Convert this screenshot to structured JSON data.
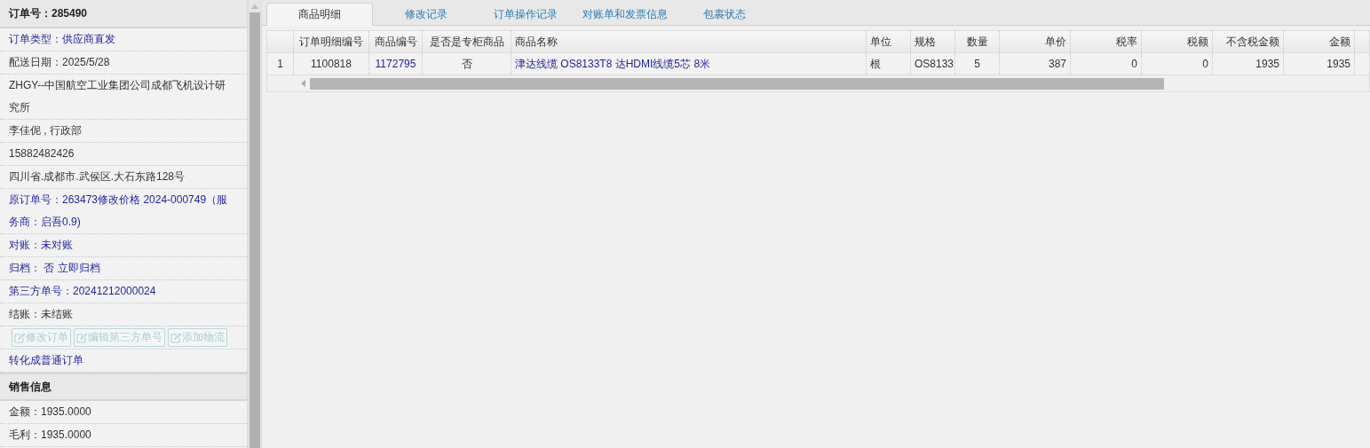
{
  "sidebar": {
    "title": "订单号：285490",
    "rows": [
      {
        "text": "订单类型：供应商直发",
        "kind": "link"
      },
      {
        "text": "配送日期：2025/5/28",
        "kind": "text"
      },
      {
        "text": "ZHGY--中国航空工业集团公司成都飞机设计研究所",
        "kind": "text"
      },
      {
        "text": "李佳伲 , 行政部",
        "kind": "text"
      },
      {
        "text": "15882482426",
        "kind": "text"
      },
      {
        "text": "四川省.成都市.武侯区.大石东路128号",
        "kind": "text"
      },
      {
        "text": "原订单号：263473修改价格 2024-000749（服务商：启吾0.9)",
        "kind": "link"
      },
      {
        "text": "对账：未对账",
        "kind": "link"
      },
      {
        "text": "归档： 否 立即归档",
        "kind": "link"
      },
      {
        "text": "第三方单号：20241212000024",
        "kind": "link"
      },
      {
        "text": "结账：未结账",
        "kind": "text"
      }
    ],
    "buttons": [
      {
        "label": "修改订单",
        "disabled": true
      },
      {
        "label": "编辑第三方单号",
        "disabled": true
      },
      {
        "label": "添加物流",
        "disabled": true
      }
    ],
    "convert_link": "转化成普通订单",
    "sales_title": "销售信息",
    "sales_rows": [
      "金额：1935.0000",
      "毛利：1935.0000"
    ]
  },
  "tabs": [
    {
      "label": "商品明细",
      "selected": true
    },
    {
      "label": "修改记录",
      "selected": false
    },
    {
      "label": "订单操作记录",
      "selected": false
    },
    {
      "label": "对账单和发票信息",
      "selected": false
    },
    {
      "label": "包裹状态",
      "selected": false
    }
  ],
  "table": {
    "columns": [
      "订单明细编号",
      "商品编号",
      "是否是专柜商品",
      "商品名称",
      "单位",
      "规格",
      "数量",
      "单价",
      "税率",
      "税额",
      "不含税金额",
      "金额"
    ],
    "rows": [
      {
        "number": "1",
        "cells": [
          {
            "text": "1100818",
            "link": false
          },
          {
            "text": "1172795",
            "link": true
          },
          {
            "text": "否",
            "link": false
          },
          {
            "text": "津达线缆 OS8133T8 达HDMI线缆5芯 8米",
            "link": true
          },
          {
            "text": "根",
            "link": false
          },
          {
            "text": "OS8133",
            "link": false
          },
          {
            "text": "5",
            "link": false
          },
          {
            "text": "387",
            "link": false
          },
          {
            "text": "0",
            "link": false
          },
          {
            "text": "0",
            "link": false
          },
          {
            "text": "1935",
            "link": false
          },
          {
            "text": "1935",
            "link": false
          }
        ]
      }
    ]
  }
}
